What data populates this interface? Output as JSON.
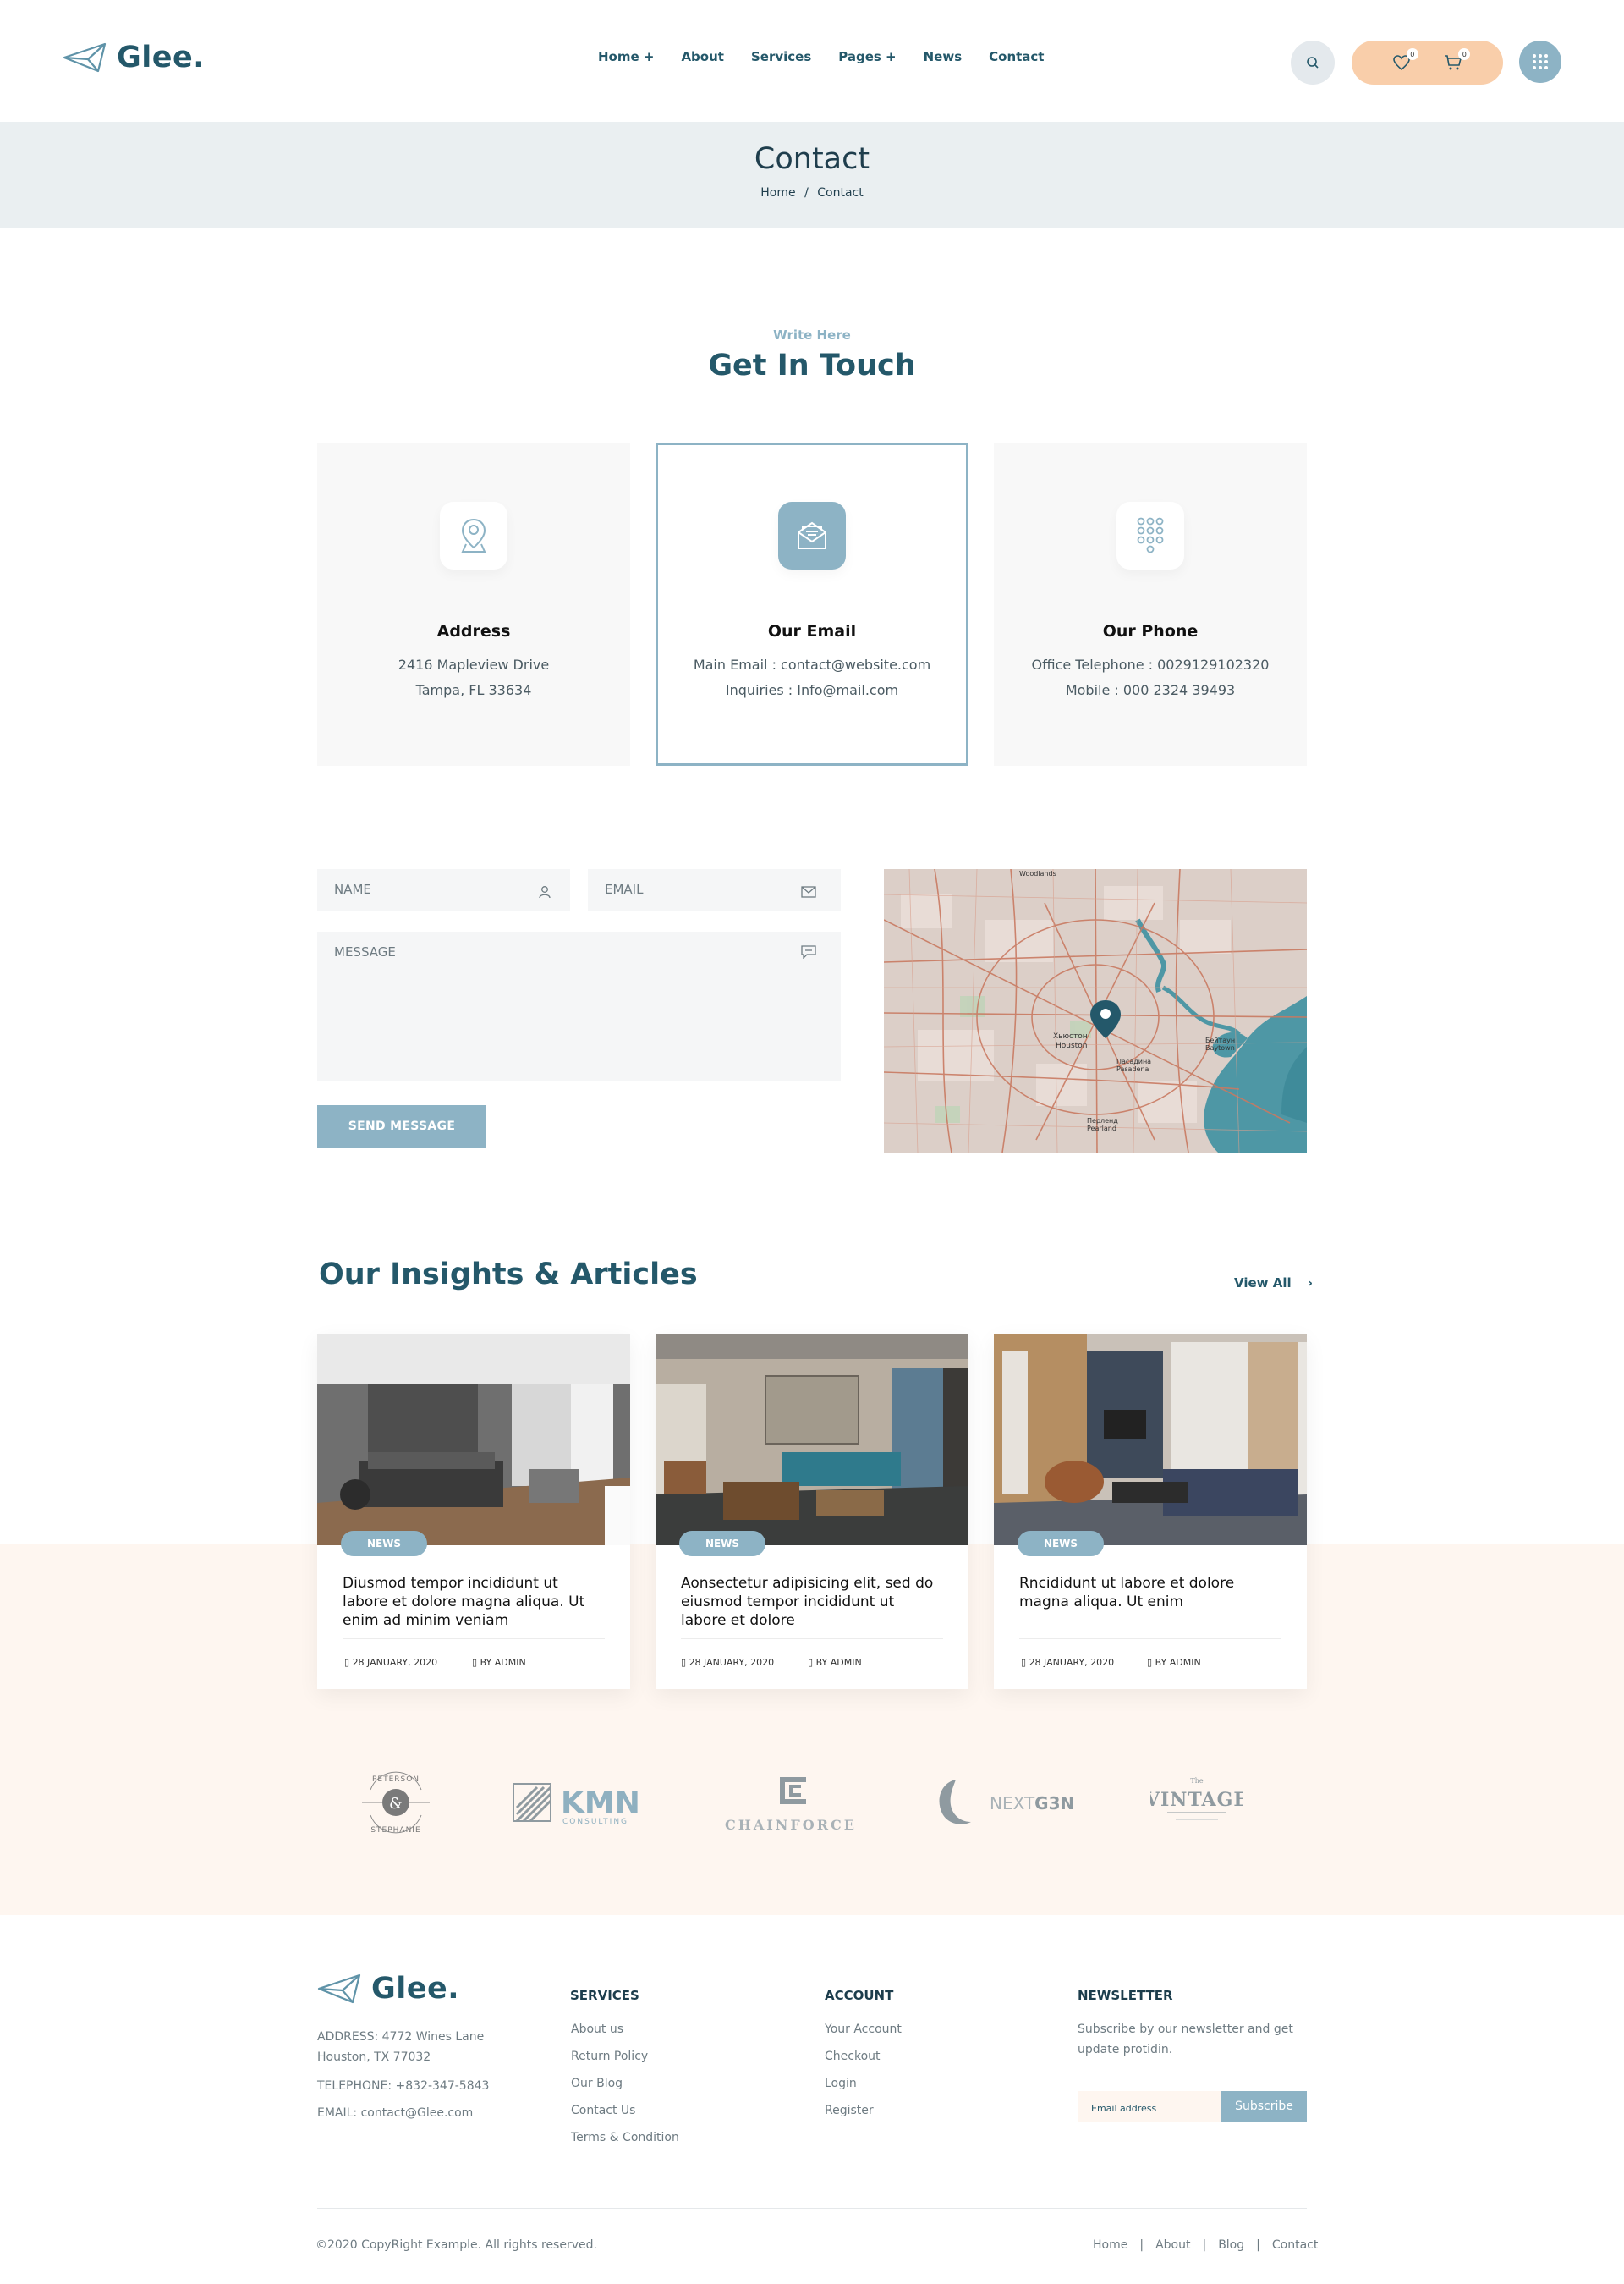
{
  "header": {
    "logo_text": "Glee.",
    "nav": [
      "Home +",
      "About",
      "Services",
      "Pages +",
      "News",
      "Contact"
    ],
    "wishlist_count": "0",
    "cart_count": "0",
    "accent_color": "#8db3c5",
    "pill_color": "#f9ceaa"
  },
  "banner": {
    "title": "Contact",
    "breadcrumb_home": "Home",
    "breadcrumb_sep": "/",
    "breadcrumb_current": "Contact"
  },
  "touch": {
    "eyebrow": "Write Here",
    "heading": "Get In Touch",
    "cards": [
      {
        "title": "Address",
        "line1": "2416 Mapleview Drive",
        "line2": "Tampa, FL 33634",
        "icon": "location-pin-icon"
      },
      {
        "title": "Our Email",
        "line1": "Main Email : contact@website.com",
        "line2": "Inquiries : Info@mail.com",
        "icon": "envelope-icon"
      },
      {
        "title": "Our Phone",
        "line1": "Office Telephone : 0029129102320",
        "line2": "Mobile : 000 2324 39493",
        "icon": "dial-pad-icon"
      }
    ]
  },
  "form": {
    "name_placeholder": "NAME",
    "email_placeholder": "EMAIL",
    "message_placeholder": "MESSAGE",
    "send_label": "SEND MESSAGE"
  },
  "map": {
    "labels": [
      "Woodlands",
      "Хьюстон",
      "Houston",
      "Пасадина",
      "Pasadena",
      "Перленд",
      "Pearland",
      "Бейтаун",
      "Baytown"
    ]
  },
  "articles": {
    "heading": "Our Insights & Articles",
    "view_all": "View All",
    "items": [
      {
        "badge": "NEWS",
        "title": "Diusmod tempor incididunt ut labore et dolore magna aliqua. Ut enim ad minim veniam",
        "date": "28 JANUARY, 2020",
        "author": "BY ADMIN"
      },
      {
        "badge": "NEWS",
        "title": "Aonsectetur adipisicing elit, sed do eiusmod tempor incididunt ut labore et dolore",
        "date": "28 JANUARY, 2020",
        "author": "BY ADMIN"
      },
      {
        "badge": "NEWS",
        "title": "Rncididunt ut labore et dolore magna aliqua. Ut enim",
        "date": "28 JANUARY, 2020",
        "author": "BY ADMIN"
      }
    ]
  },
  "brands": [
    "PETERSON & STEPHANIE",
    "KMN CONSULTING",
    "CHAINFORCE",
    "NEXTG3N",
    "VINTAGE"
  ],
  "footer": {
    "logo_text": "Glee.",
    "address_line1": "ADDRESS: 4772 Wines Lane",
    "address_line2": "Houston, TX 77032",
    "telephone": "TELEPHONE: +832-347-5843",
    "email": "EMAIL: contact@Glee.com",
    "services_title": "SERVICES",
    "services": [
      "About us",
      "Return Policy",
      "Our Blog",
      "Contact Us",
      "Terms & Condition"
    ],
    "account_title": "ACCOUNT",
    "account": [
      "Your Account",
      "Checkout",
      "Login",
      "Register"
    ],
    "newsletter_title": "NEWSLETTER",
    "newsletter_text_1": "Subscribe by our newsletter and get",
    "newsletter_text_2": "update protidin.",
    "email_placeholder": "Email address",
    "subscribe_label": "Subscribe",
    "copyright": "©2020 CopyRight Example. All rights reserved.",
    "links": [
      "Home",
      "About",
      "Blog",
      "Contact"
    ]
  }
}
